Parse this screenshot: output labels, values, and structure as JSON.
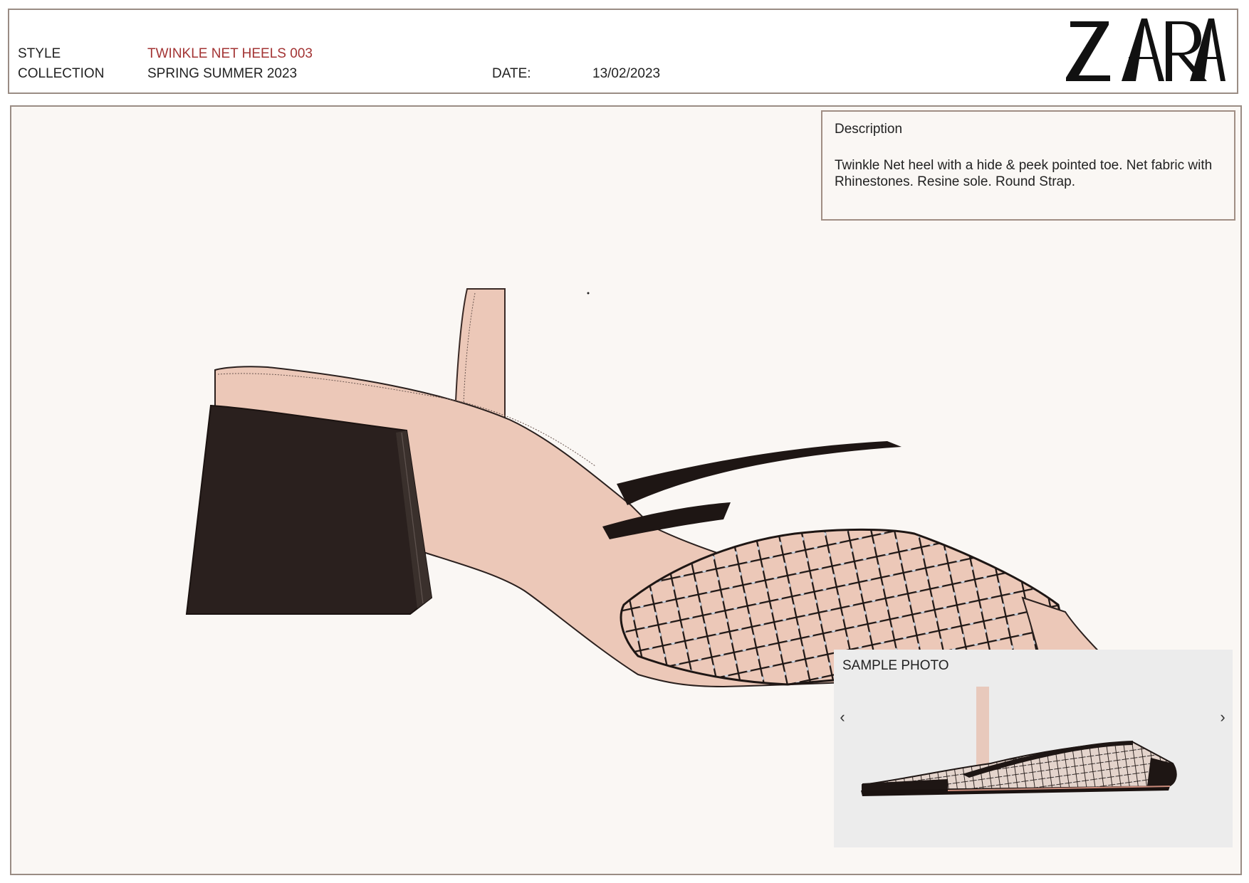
{
  "header": {
    "style_label": "STYLE",
    "style_value": "TWINKLE NET HEELS 003",
    "collection_label": "COLLECTION",
    "collection_value": "SPRING SUMMER 2023",
    "date_label": "DATE:",
    "date_value": "13/02/2023",
    "brand": "ZARA"
  },
  "description": {
    "title": "Description",
    "body": "Twinkle Net heel with a hide & peek pointed toe. Net fabric with Rhinestones. Resine sole. Round Strap."
  },
  "sample": {
    "title": "SAMPLE PHOTO",
    "prev_icon": "‹",
    "next_icon": "›"
  },
  "colors": {
    "accent_red": "#a33434",
    "border": "#9a8c84",
    "nude": "#ecc8b8",
    "heel": "#2a201e",
    "mesh": "#1e1614",
    "rhinestone": "#cfd6e0"
  }
}
